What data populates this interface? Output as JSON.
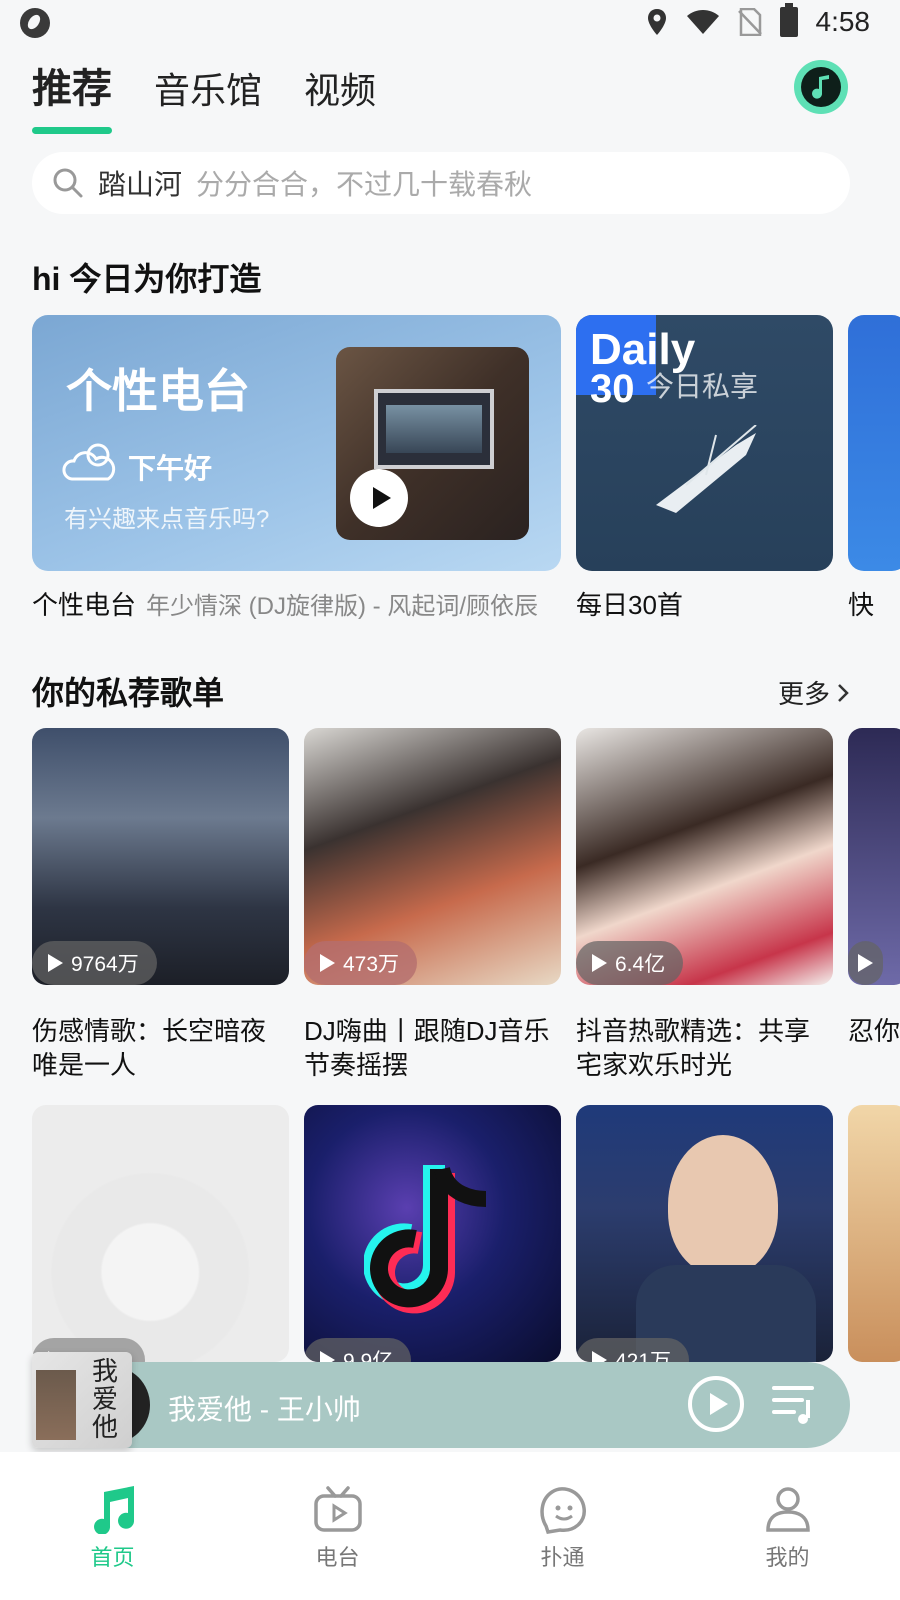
{
  "status_bar": {
    "time": "4:58"
  },
  "top_tabs": [
    {
      "label": "推荐",
      "active": true
    },
    {
      "label": "音乐馆",
      "active": false
    },
    {
      "label": "视频",
      "active": false
    }
  ],
  "search": {
    "keyword": "踏山河",
    "hint": "分分合合，不过几十载春秋"
  },
  "today": {
    "title": "hi 今日为你打造",
    "radio_card": {
      "title": "个性电台",
      "greeting": "下午好",
      "subtitle": "有兴趣来点音乐吗?"
    },
    "daily_card": {
      "badge_word": "Daily",
      "badge_num": "30",
      "badge_cn": "今日私享"
    },
    "captions": [
      {
        "title": "个性电台",
        "sub": "年少情深 (DJ旋律版) - 风起词/顾依辰"
      },
      {
        "title": "每日30首",
        "sub": ""
      },
      {
        "title": "快",
        "sub": ""
      }
    ]
  },
  "playlists": {
    "title": "你的私荐歌单",
    "more_label": "更多",
    "row1": [
      {
        "count": "9764万",
        "title": "伤感情歌：长空暗夜唯是一人"
      },
      {
        "count": "473万",
        "title": "DJ嗨曲丨跟随DJ音乐节奏摇摆"
      },
      {
        "count": "6.4亿",
        "title": "抖音热歌精选：共享宅家欢乐时光"
      },
      {
        "count": "",
        "title": "忍你"
      }
    ],
    "row2": [
      {
        "count": "165万"
      },
      {
        "count": "9.9亿"
      },
      {
        "count": "421万"
      }
    ]
  },
  "mini_player": {
    "text": "我爱他 - 王小帅",
    "cover_text": "我爱他"
  },
  "bottom_nav": [
    {
      "label": "首页",
      "icon": "music-note-icon",
      "active": true
    },
    {
      "label": "电台",
      "icon": "tv-radio-icon",
      "active": false
    },
    {
      "label": "扑通",
      "icon": "face-bubble-icon",
      "active": false
    },
    {
      "label": "我的",
      "icon": "person-icon",
      "active": false
    }
  ],
  "colors": {
    "accent": "#1fc98a",
    "mini_player_bg": "#a9c8c4"
  }
}
